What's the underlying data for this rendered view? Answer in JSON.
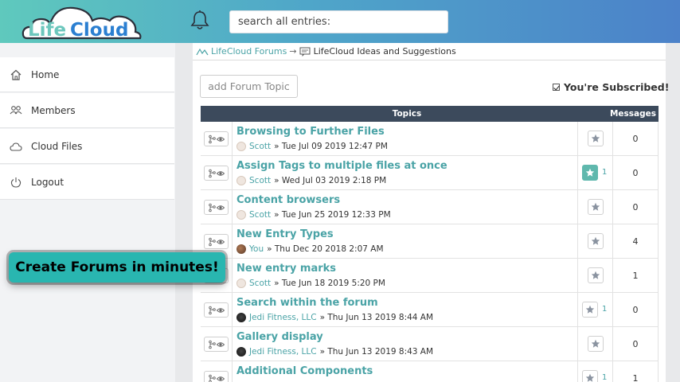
{
  "header": {
    "logo_text_life": "Life",
    "logo_text_cloud": "Cloud",
    "search_placeholder": "search all entries:"
  },
  "sidebar": {
    "items": [
      {
        "label": "Home",
        "icon": "home-icon"
      },
      {
        "label": "Members",
        "icon": "members-icon"
      },
      {
        "label": "Cloud Files",
        "icon": "cloud-icon"
      },
      {
        "label": "Logout",
        "icon": "power-icon"
      }
    ]
  },
  "breadcrumb": {
    "root": "LifeCloud Forums",
    "separator": "→",
    "current": "LifeCloud Ideas and Suggestions"
  },
  "toolbar": {
    "add_topic_label": "add Forum Topic",
    "subscribed_label": "You're Subscribed!"
  },
  "table": {
    "col_topics": "Topics",
    "col_messages": "Messages",
    "rows": [
      {
        "title": "Browsing to Further Files",
        "author": "Scott",
        "date": "» Tue Jul 09 2019 12:47 PM",
        "favorited": false,
        "fav_count": "",
        "messages": "0"
      },
      {
        "title": "Assign Tags to multiple files at once",
        "author": "Scott",
        "date": "» Wed Jul 03 2019 2:18 PM",
        "favorited": true,
        "fav_count": "1",
        "messages": "0"
      },
      {
        "title": "Content browsers",
        "author": "Scott",
        "date": "» Tue Jun 25 2019 12:33 PM",
        "favorited": false,
        "fav_count": "",
        "messages": "0"
      },
      {
        "title": "New Entry Types",
        "author": "You",
        "date": "» Thu Dec 20 2018 2:07 AM",
        "favorited": false,
        "fav_count": "",
        "messages": "4"
      },
      {
        "title": "New entry marks",
        "author": "Scott",
        "date": "» Tue Jun 18 2019 5:20 PM",
        "favorited": false,
        "fav_count": "",
        "messages": "1"
      },
      {
        "title": "Search within the forum",
        "author": "Jedi Fitness, LLC",
        "date": "» Thu Jun 13 2019 8:44 AM",
        "favorited": false,
        "fav_count": "1",
        "messages": "0"
      },
      {
        "title": "Gallery display",
        "author": "Jedi Fitness, LLC",
        "date": "» Thu Jun 13 2019 8:43 AM",
        "favorited": false,
        "fav_count": "",
        "messages": "0"
      },
      {
        "title": "Additional Components",
        "author": "",
        "date": "",
        "favorited": false,
        "fav_count": "1",
        "messages": "1"
      }
    ]
  },
  "callout": {
    "text": "Create Forums in minutes!"
  },
  "colors": {
    "accent": "#4aa3a6",
    "header_dark": "#3c4a5c",
    "favorite_on": "#5fb8ad"
  }
}
